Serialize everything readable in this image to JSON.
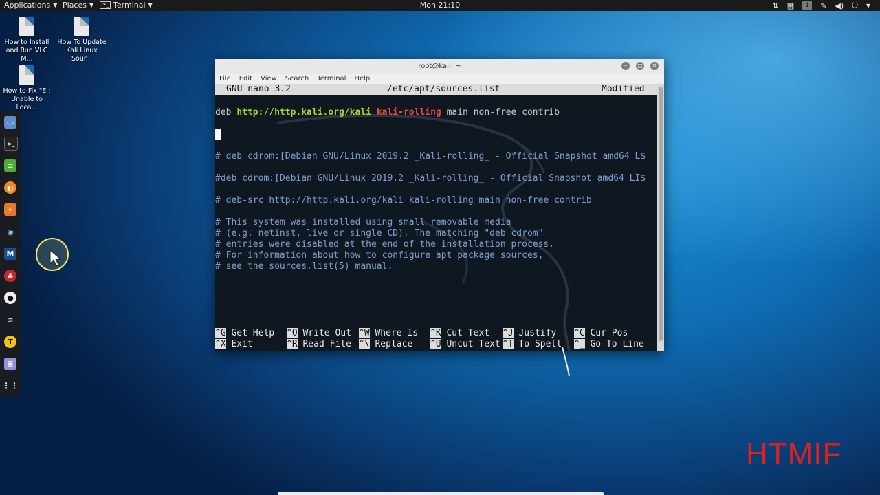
{
  "topbar": {
    "applications": "Applications",
    "places": "Places",
    "terminal": "Terminal",
    "clock": "Mon 21:10",
    "workspace": "1"
  },
  "desktop_icons": [
    {
      "label1": "How to Install",
      "label2": "and Run VLC M..."
    },
    {
      "label1": "How To Update",
      "label2": "Kali Linux Sour..."
    },
    {
      "label1": "How to Fix  \"E :",
      "label2": "Unable to Loca..."
    }
  ],
  "dock": {
    "icons": [
      "files-icon",
      "terminal-icon",
      "notes-icon",
      "browser-icon",
      "burp-icon",
      "eye-icon",
      "metasploit-icon",
      "cherry-icon",
      "armitage-icon",
      "wifi-icon",
      "maltego-icon",
      "text-editor-icon",
      "app-grid-icon"
    ]
  },
  "window": {
    "title": "root@kali: ~",
    "menu": [
      "File",
      "Edit",
      "View",
      "Search",
      "Terminal",
      "Help"
    ]
  },
  "nano": {
    "version": "GNU nano 3.2",
    "filename": "/etc/apt/sources.list",
    "status": "Modified",
    "deb_line": {
      "kw": "deb",
      "url": "http://http.kali.org/kali",
      "suite": "kali-rolling",
      "rest": "main non-free contrib"
    },
    "comment1": "# deb cdrom:[Debian GNU/Linux 2019.2 _Kali-rolling_ - Official Snapshot amd64 L$",
    "comment2": "#deb cdrom:[Debian GNU/Linux 2019.2 _Kali-rolling_ - Official Snapshot amd64 LI$",
    "comment3": "# deb-src http://http.kali.org/kali kali-rolling main non-free contrib",
    "comment_block": [
      "# This system was installed using small removable media",
      "# (e.g. netinst, live or single CD). The matching \"deb cdrom\"",
      "# entries were disabled at the end of the installation process.",
      "# For information about how to configure apt package sources,",
      "# see the sources.list(5) manual."
    ],
    "shortcuts_row1": [
      {
        "key": "^G",
        "label": "Get Help"
      },
      {
        "key": "^O",
        "label": "Write Out"
      },
      {
        "key": "^W",
        "label": "Where Is"
      },
      {
        "key": "^K",
        "label": "Cut Text"
      },
      {
        "key": "^J",
        "label": "Justify"
      },
      {
        "key": "^C",
        "label": "Cur Pos"
      }
    ],
    "shortcuts_row2": [
      {
        "key": "^X",
        "label": "Exit"
      },
      {
        "key": "^R",
        "label": "Read File"
      },
      {
        "key": "^\\",
        "label": "Replace"
      },
      {
        "key": "^U",
        "label": "Uncut Text"
      },
      {
        "key": "^T",
        "label": "To Spell"
      },
      {
        "key": "^_",
        "label": "Go To Line"
      }
    ]
  },
  "watermark": "HTMIF"
}
